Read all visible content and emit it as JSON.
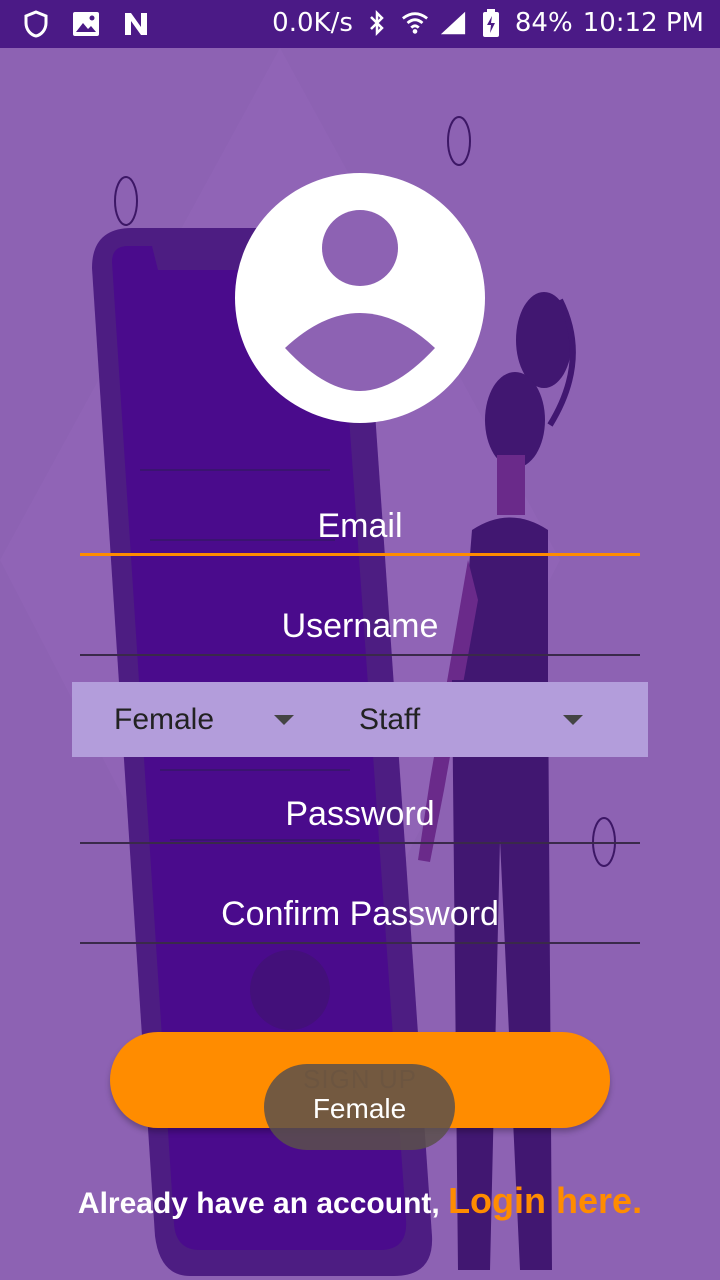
{
  "status_bar": {
    "net_speed": "0.0K/s",
    "battery": "84%",
    "time": "10:12 PM",
    "icons": [
      "shield-icon",
      "image-icon",
      "n-logo-icon",
      "bluetooth-icon",
      "wifi-icon",
      "signal-icon",
      "battery-charging-icon"
    ]
  },
  "form": {
    "email_placeholder": "Email",
    "username_placeholder": "Username",
    "password_placeholder": "Password",
    "confirm_password_placeholder": "Confirm Password",
    "gender_selected": "Female",
    "role_selected": "Staff"
  },
  "signup_label": "SIGN UP",
  "toast_text": "Female",
  "footer": {
    "message": "Already have an account, ",
    "login_link": "Login here."
  },
  "colors": {
    "background": "#8d62b3",
    "status_bar": "#4b1a86",
    "accent": "#ff8c00",
    "spinner_bg": "#b39ddb"
  }
}
